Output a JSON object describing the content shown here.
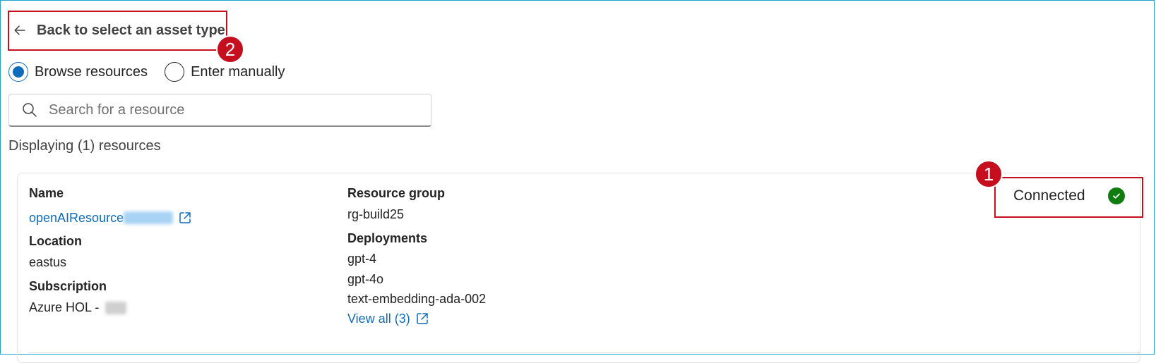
{
  "header": {
    "back_label": "Back to select an asset type"
  },
  "annotations": {
    "badge_1": "1",
    "badge_2": "2"
  },
  "source_mode": {
    "options": [
      {
        "label": "Browse resources",
        "selected": true
      },
      {
        "label": "Enter manually",
        "selected": false
      }
    ]
  },
  "search": {
    "placeholder": "Search for a resource",
    "value": ""
  },
  "results": {
    "count_text": "Displaying (1) resources"
  },
  "resource": {
    "name_label": "Name",
    "name_value": "openAIResource",
    "location_label": "Location",
    "location_value": "eastus",
    "subscription_label": "Subscription",
    "subscription_value": "Azure HOL -",
    "resource_group_label": "Resource group",
    "resource_group_value": "rg-build25",
    "deployments_label": "Deployments",
    "deployments": [
      "gpt-4",
      "gpt-4o",
      "text-embedding-ada-002"
    ],
    "view_all_label": "View all (3)",
    "status": "Connected"
  },
  "colors": {
    "accent": "#0f6cbd",
    "annotation_red": "#c50f1f",
    "success_green": "#107c10"
  },
  "icons": {
    "back": "arrow-left-icon",
    "search": "search-icon",
    "external": "open-external-icon",
    "status": "checkmark-circle-icon"
  }
}
